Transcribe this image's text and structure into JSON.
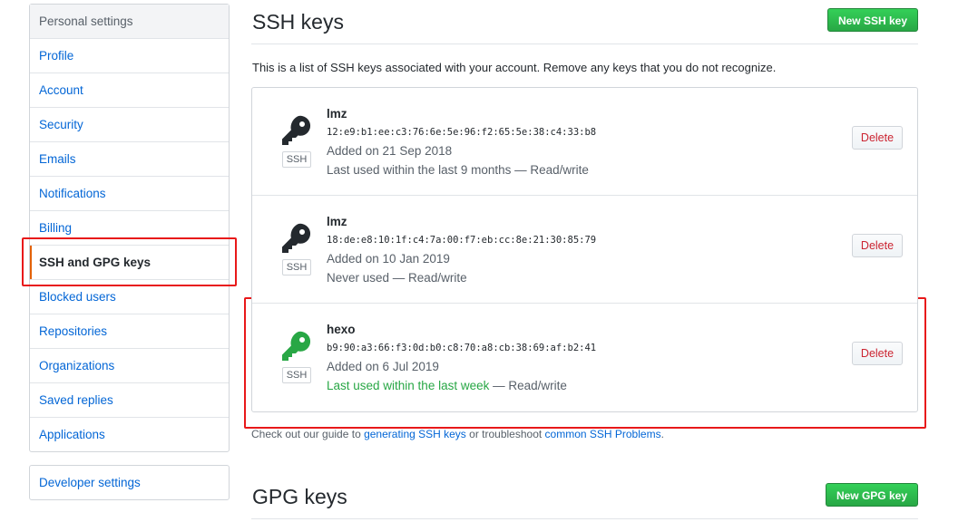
{
  "sidebar": {
    "heading": "Personal settings",
    "items": [
      {
        "label": "Profile"
      },
      {
        "label": "Account"
      },
      {
        "label": "Security"
      },
      {
        "label": "Emails"
      },
      {
        "label": "Notifications"
      },
      {
        "label": "Billing"
      },
      {
        "label": "SSH and GPG keys",
        "selected": true
      },
      {
        "label": "Blocked users"
      },
      {
        "label": "Repositories"
      },
      {
        "label": "Organizations"
      },
      {
        "label": "Saved replies"
      },
      {
        "label": "Applications"
      }
    ],
    "developer_settings": "Developer settings"
  },
  "ssh": {
    "title": "SSH keys",
    "new_button": "New SSH key",
    "intro": "This is a list of SSH keys associated with your account. Remove any keys that you do not recognize.",
    "keys": [
      {
        "title": "lmz",
        "fingerprint": "12:e9:b1:ee:c3:76:6e:5e:96:f2:65:5e:38:c4:33:b8",
        "added": "Added on 21 Sep 2018",
        "last_used": "Last used within the last 9 months",
        "access": " — Read/write",
        "type_label": "SSH",
        "delete_label": "Delete",
        "icon_color": "#24292e"
      },
      {
        "title": "lmz",
        "fingerprint": "18:de:e8:10:1f:c4:7a:00:f7:eb:cc:8e:21:30:85:79",
        "added": "Added on 10 Jan 2019",
        "last_used": "Never used",
        "access": " — Read/write",
        "type_label": "SSH",
        "delete_label": "Delete",
        "icon_color": "#24292e"
      },
      {
        "title": "hexo",
        "fingerprint": "b9:90:a3:66:f3:0d:b0:c8:70:a8:cb:38:69:af:b2:41",
        "added": "Added on 6 Jul 2019",
        "last_used": "Last used within the last week",
        "access": " — Read/write",
        "type_label": "SSH",
        "delete_label": "Delete",
        "icon_color": "#28a745",
        "recent": true
      }
    ],
    "footnote": {
      "pre": "Check out our guide to ",
      "link1": "generating SSH keys",
      "mid": " or troubleshoot ",
      "link2": "common SSH Problems",
      "post": "."
    }
  },
  "gpg": {
    "title": "GPG keys",
    "new_button": "New GPG key"
  },
  "colors": {
    "link": "#0366d6",
    "selected_border": "#e36209",
    "green_button": "#28a745",
    "danger_text": "#cb2431",
    "annotation": "#e8191a"
  }
}
